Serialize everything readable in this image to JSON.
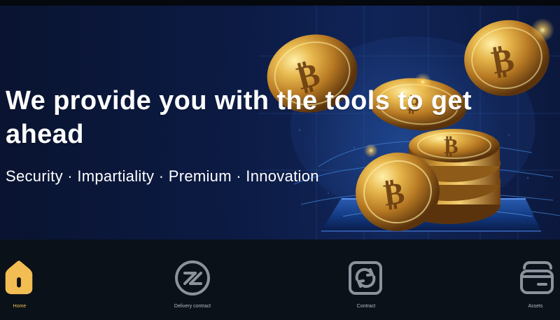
{
  "hero": {
    "title": "We provide you with the tools to get ahead",
    "subtitle": "Security · Impartiality · Premium · Innovation"
  },
  "bottom_nav": {
    "items": [
      {
        "label": "Home",
        "icon": "home-icon",
        "active": true
      },
      {
        "label": "Delivery contract",
        "icon": "delivery-contract-icon",
        "active": false
      },
      {
        "label": "Contract",
        "icon": "contract-refresh-icon",
        "active": false
      },
      {
        "label": "Assets",
        "icon": "wallet-icon",
        "active": false
      }
    ]
  },
  "colors": {
    "hero_background": "#0c1b45",
    "bottom_nav_background": "#0b1118",
    "active_gold": "#f2bd52",
    "inactive_gray": "#b7bcc5",
    "coin_gold": "#d8a33a"
  }
}
